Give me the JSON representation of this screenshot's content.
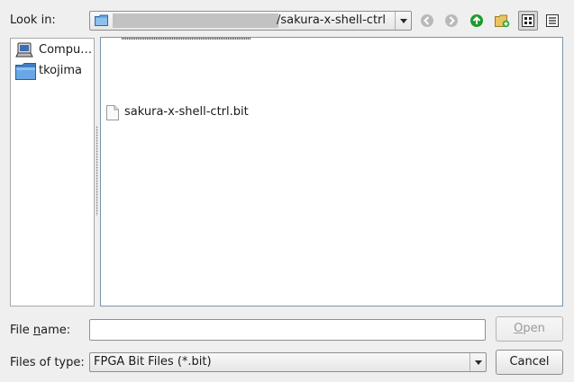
{
  "look_in": {
    "label": "Look in:",
    "path_visible": "/sakura-x-shell-ctrl"
  },
  "toolbar": {
    "icons": [
      "back-icon",
      "forward-icon",
      "parent-directory-icon",
      "new-folder-icon",
      "list-view-icon",
      "detail-view-icon"
    ],
    "active_view": "list-view"
  },
  "places": {
    "items": [
      {
        "label": "Compu…",
        "icon": "computer-icon"
      },
      {
        "label": "tkojima",
        "icon": "folder-icon"
      }
    ]
  },
  "files": {
    "items": [
      {
        "label": "sakura-x-shell-ctrl.bit",
        "icon": "file-icon"
      }
    ]
  },
  "file_name": {
    "label_pre": "File ",
    "label_mnemonic": "n",
    "label_post": "ame:",
    "value": ""
  },
  "file_type": {
    "label": "Files of type:",
    "selected": "FPGA Bit Files (*.bit)"
  },
  "buttons": {
    "open_mnemonic": "O",
    "open_rest": "pen",
    "cancel": "Cancel"
  },
  "colors": {
    "window_bg": "#efefef",
    "folder_blue": "#5f9ed9",
    "up_arrow_green": "#1e9a2e",
    "view_border": "#7b95ad"
  }
}
